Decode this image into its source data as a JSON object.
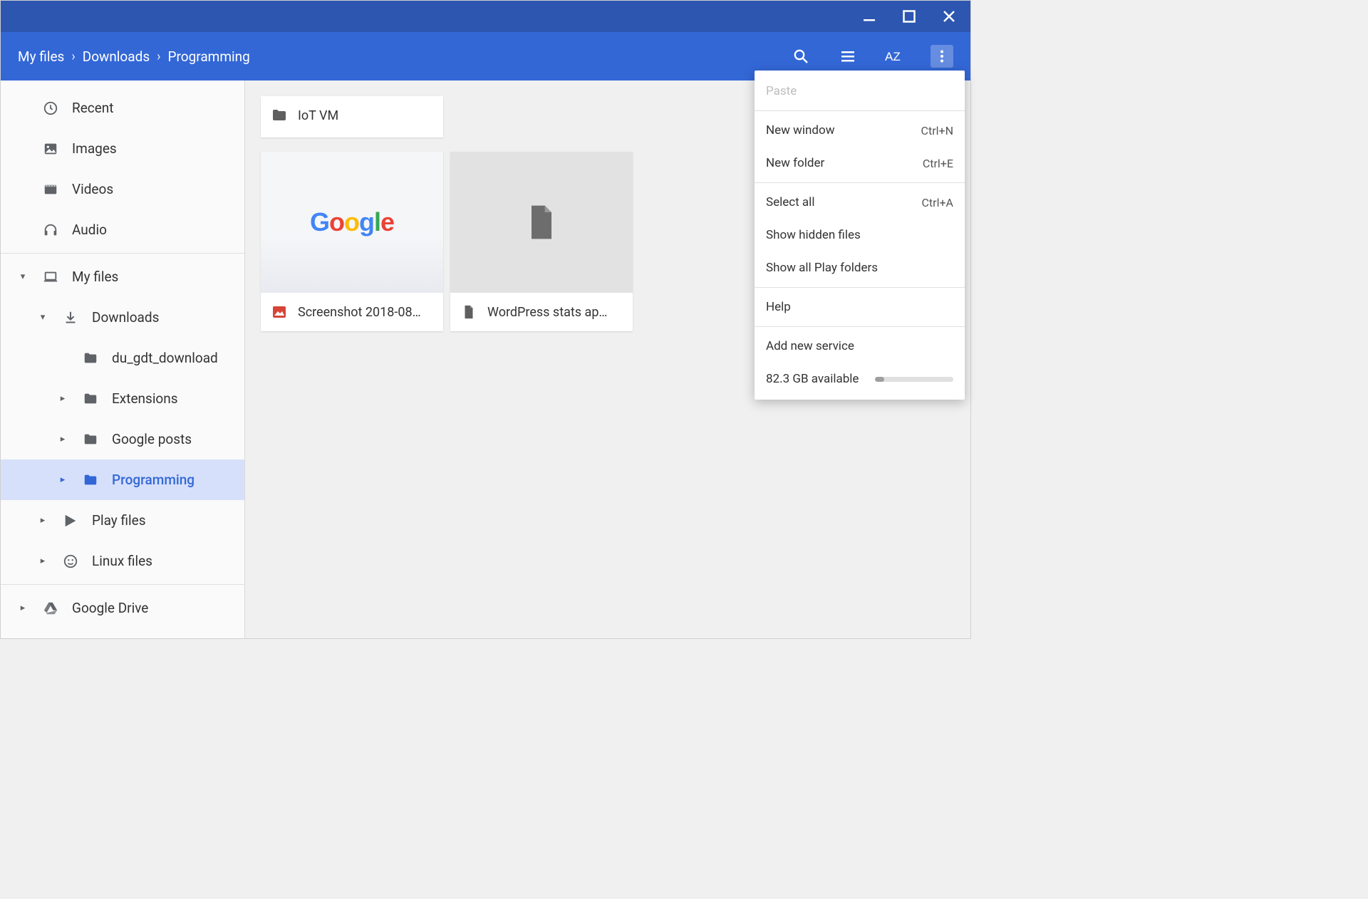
{
  "breadcrumb": {
    "items": [
      "My files",
      "Downloads",
      "Programming"
    ]
  },
  "sidebar": {
    "recent": "Recent",
    "images": "Images",
    "videos": "Videos",
    "audio": "Audio",
    "myfiles": "My files",
    "downloads": "Downloads",
    "du_gdt": "du_gdt_download",
    "extensions": "Extensions",
    "google_posts": "Google posts",
    "programming": "Programming",
    "play_files": "Play files",
    "linux_files": "Linux files",
    "drive": "Google Drive"
  },
  "tiles": {
    "folder1": "IoT VM",
    "file1": "Screenshot 2018-08…",
    "file2": "WordPress stats ap…"
  },
  "menu": {
    "paste": "Paste",
    "new_window": "New window",
    "new_window_sc": "Ctrl+N",
    "new_folder": "New folder",
    "new_folder_sc": "Ctrl+E",
    "select_all": "Select all",
    "select_all_sc": "Ctrl+A",
    "hidden": "Show hidden files",
    "play_folders": "Show all Play folders",
    "help": "Help",
    "add_service": "Add new service",
    "storage": "82.3 GB available"
  }
}
